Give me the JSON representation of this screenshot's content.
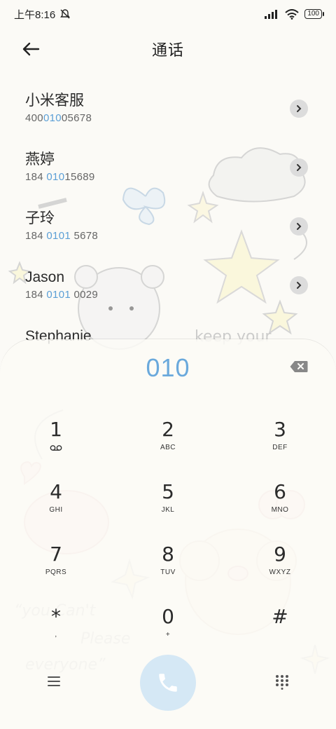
{
  "status_bar": {
    "time": "上午8:16",
    "battery": "100"
  },
  "header": {
    "title": "通话",
    "back_icon": "back-arrow-icon"
  },
  "contacts": [
    {
      "name": "小米客服",
      "number_pre": "400",
      "number_match": "010",
      "number_post": "05678"
    },
    {
      "name": "燕婷",
      "number_pre": "184 ",
      "number_match": "010",
      "number_post": "15689"
    },
    {
      "name": "子玲",
      "number_pre": "184 ",
      "number_match": "0101",
      "number_post": " 5678"
    },
    {
      "name": "Jason",
      "number_pre": "184 ",
      "number_match": "0101",
      "number_post": " 0029"
    },
    {
      "name": "Stephanie",
      "number_pre": "",
      "number_match": "",
      "number_post": ""
    }
  ],
  "dialer": {
    "input": "010",
    "keys": [
      {
        "digit": "1",
        "letters": ""
      },
      {
        "digit": "2",
        "letters": "ABC"
      },
      {
        "digit": "3",
        "letters": "DEF"
      },
      {
        "digit": "4",
        "letters": "GHI"
      },
      {
        "digit": "5",
        "letters": "JKL"
      },
      {
        "digit": "6",
        "letters": "MNO"
      },
      {
        "digit": "7",
        "letters": "PQRS"
      },
      {
        "digit": "8",
        "letters": "TUV"
      },
      {
        "digit": "9",
        "letters": "WXYZ"
      },
      {
        "digit": "*",
        "letters": ","
      },
      {
        "digit": "0",
        "letters": "+"
      },
      {
        "digit": "#",
        "letters": ""
      }
    ]
  },
  "decor_text": {
    "keep": "keep your",
    "quote1": "“you Can't",
    "quote2": "Please",
    "quote3": "everyone”"
  },
  "colors": {
    "accent": "#6aa9dc",
    "match_highlight": "#5b9fd6",
    "call_button": "#d5e8f5",
    "background": "#fbfaf6"
  }
}
